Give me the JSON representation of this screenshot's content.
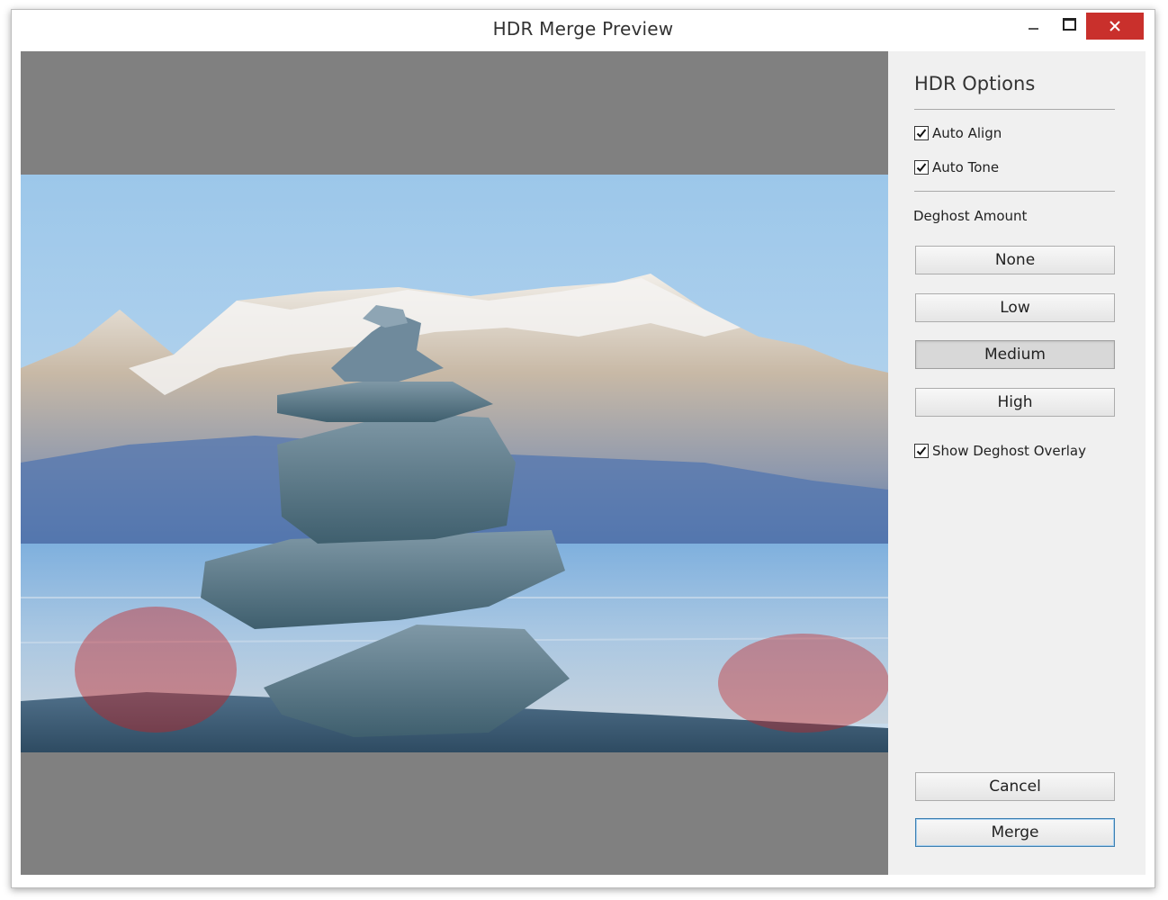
{
  "window": {
    "title": "HDR Merge Preview",
    "controls": {
      "minimize_icon": "minimize-icon",
      "maximize_icon": "maximize-icon",
      "close_icon": "close-icon"
    },
    "close_color": "#c9302c"
  },
  "preview": {
    "background_color": "#808080",
    "overlay_color": "#c82020"
  },
  "panel": {
    "title": "HDR Options",
    "auto_align": {
      "label": "Auto Align",
      "checked": true
    },
    "auto_tone": {
      "label": "Auto Tone",
      "checked": true
    },
    "deghost_label": "Deghost Amount",
    "deghost_options": [
      "None",
      "Low",
      "Medium",
      "High"
    ],
    "deghost_selected": "Medium",
    "show_overlay": {
      "label": "Show Deghost Overlay",
      "checked": true
    },
    "cancel_label": "Cancel",
    "merge_label": "Merge"
  }
}
